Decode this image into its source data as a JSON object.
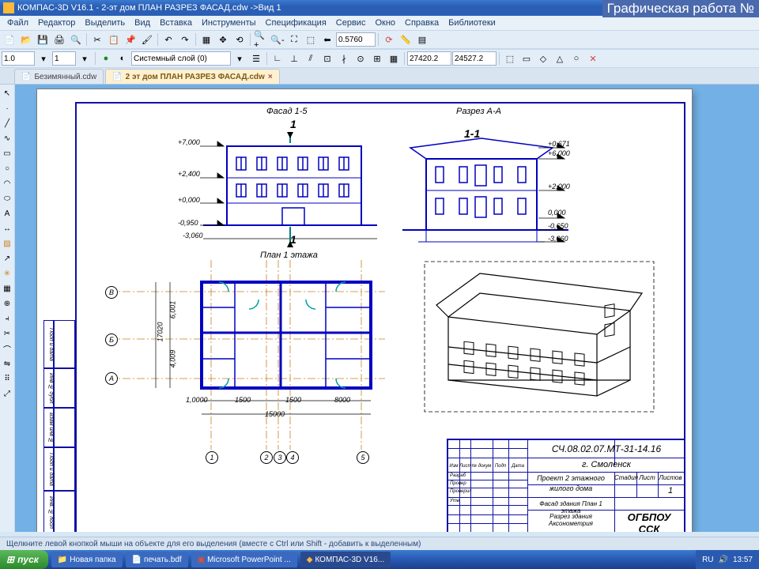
{
  "overlay_title": "Графическая работа №",
  "window": {
    "title": "КОМПАС-3D V16.1 - 2-эт дом ПЛАН РАЗРЕЗ ФАСАД.cdw ->Вид 1"
  },
  "menu": {
    "items": [
      "Файл",
      "Редактор",
      "Выделить",
      "Вид",
      "Вставка",
      "Инструменты",
      "Спецификация",
      "Сервис",
      "Окно",
      "Справка",
      "Библиотеки"
    ]
  },
  "toolbar2": {
    "stroke": "1.0",
    "layer": "1",
    "layer_combo": "Системный слой (0)",
    "coord_x": "27420.2",
    "coord_y": "24527.2"
  },
  "toolbar1": {
    "zoom": "0.5760"
  },
  "tabs": [
    {
      "label": "Безимянный.cdw",
      "active": false
    },
    {
      "label": "2 эт дом ПЛАН РАЗРЕЗ ФАСАД.cdw",
      "active": true
    }
  ],
  "drawing": {
    "facade_title": "Фасад 1-5",
    "section_title": "Разрез А-А",
    "section_mark": "1-1",
    "cut_mark": "1",
    "plan_title": "План 1 этажа",
    "elev": {
      "e1": "+7,000",
      "e2": "+2,400",
      "e3": "+0,000",
      "e4": "-0,950",
      "e5": "+0,671",
      "e6": "+6,000",
      "e7": "+2,000",
      "e8": "0,000",
      "e9": "-0,650",
      "e10": "-3,060",
      "e11": "-3,060"
    },
    "plan_dims": {
      "d1": "17020",
      "d2": "6,001",
      "d3": "4,009",
      "d4": "1,0000",
      "d5": "1500",
      "d6": "1500",
      "d7": "8000",
      "d8": "15000"
    },
    "axes": {
      "a": "А",
      "b": "Б",
      "v": "В",
      "n1": "1",
      "n2": "2",
      "n3": "3",
      "n4": "4",
      "n5": "5"
    }
  },
  "title_block": {
    "code": "СЧ.08.02.07.МТ-31-14.16",
    "city": "г. Смоленск",
    "project1": "Проект 2 этажного",
    "project2": "жилого дома",
    "sheet1": "Фасад здания План 1 этажа",
    "sheet2": "Разрез здания Аксонометрия",
    "org": "ОГБПОУ ССК",
    "h_stage": "Стадия",
    "h_sheet": "Лист",
    "h_sheets": "Листов",
    "sheet_no": "1",
    "col_labels": [
      "Изм",
      "Лист",
      "№ докум",
      "Подп",
      "Дата"
    ],
    "row_labels": [
      "Разраб",
      "Провер",
      "",
      "Проверил",
      "Утв"
    ]
  },
  "left_stamp": {
    "c1": "Инв. № подл",
    "c2": "Подп и дата",
    "c3": "Взам инв №",
    "c4": "Инв № дубл",
    "c5": "Подп и дата"
  },
  "status": "Щелкните левой кнопкой мыши на объекте для его выделения (вместе с Ctrl или Shift - добавить к выделенным)",
  "taskbar": {
    "start": "пуск",
    "items": [
      "Новая папка",
      "печать.bdf",
      "Microsoft PowerPoint ...",
      "КОМПАС-3D V16..."
    ],
    "lang": "RU",
    "time": "13:57"
  }
}
